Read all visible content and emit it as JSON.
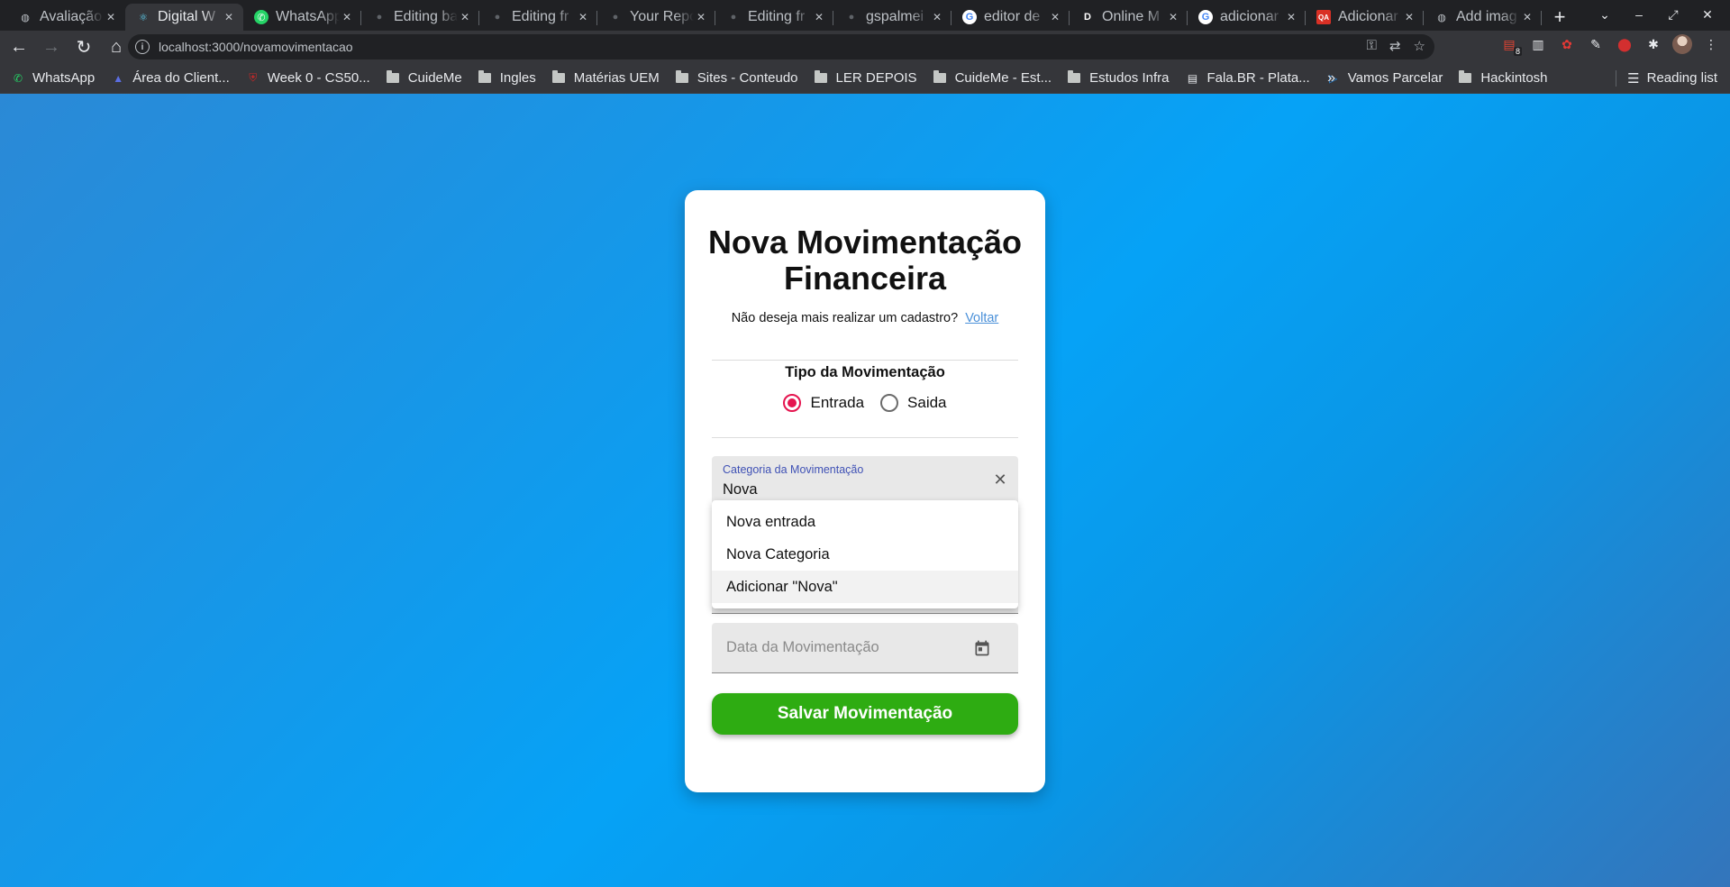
{
  "browser": {
    "tabs": [
      {
        "title": "Avaliação",
        "icon": "globe-icon"
      },
      {
        "title": "Digital W",
        "icon": "react-icon",
        "active": true
      },
      {
        "title": "WhatsApp",
        "icon": "whatsapp-icon"
      },
      {
        "title": "Editing ba",
        "icon": "github-icon"
      },
      {
        "title": "Editing fr",
        "icon": "github-icon"
      },
      {
        "title": "Your Repo",
        "icon": "github-icon"
      },
      {
        "title": "Editing fr",
        "icon": "github-icon"
      },
      {
        "title": "gspalmei",
        "icon": "github-icon"
      },
      {
        "title": "editor de",
        "icon": "google-icon"
      },
      {
        "title": "Online M",
        "icon": "d-icon"
      },
      {
        "title": "adicionar",
        "icon": "google-icon"
      },
      {
        "title": "Adicionar",
        "icon": "qa-icon"
      },
      {
        "title": "Add imag",
        "icon": "globe-icon"
      }
    ],
    "url": "localhost:3000/novamovimentacao",
    "extension_badge": "8",
    "bookmarks": [
      {
        "label": "WhatsApp",
        "icon": "whatsapp-icon"
      },
      {
        "label": "Área do Client...",
        "icon": "logo-icon"
      },
      {
        "label": "Week 0 - CS50...",
        "icon": "cs50-icon"
      },
      {
        "label": "CuideMe",
        "icon": "folder-icon"
      },
      {
        "label": "Ingles",
        "icon": "folder-icon"
      },
      {
        "label": "Matérias  UEM",
        "icon": "folder-icon"
      },
      {
        "label": "Sites - Conteudo",
        "icon": "folder-icon"
      },
      {
        "label": "LER DEPOIS",
        "icon": "folder-icon"
      },
      {
        "label": "CuideMe - Est...",
        "icon": "folder-icon"
      },
      {
        "label": "Estudos Infra",
        "icon": "folder-icon"
      },
      {
        "label": "Fala.BR - Plata...",
        "icon": "doc-icon"
      },
      {
        "label": "Vamos Parcelar",
        "icon": "play-icon"
      },
      {
        "label": "Hackintosh",
        "icon": "folder-icon"
      }
    ],
    "reading_list": "Reading list"
  },
  "form": {
    "title": "Nova Movimentação Financeira",
    "subtitle": "Não deseja mais realizar um cadastro?",
    "back_link": "Voltar",
    "tipo_label": "Tipo da Movimentação",
    "radio_entrada": "Entrada",
    "radio_saida": "Saida",
    "selected_tipo": "Entrada",
    "categoria_label": "Categoria da Movimentação",
    "categoria_value": "Nova",
    "categoria_options": [
      "Nova entrada",
      "Nova Categoria",
      "Adicionar \"Nova\""
    ],
    "data_placeholder": "Data da Movimentação",
    "save_label": "Salvar Movimentação"
  },
  "colors": {
    "accent_radio": "#e5154f",
    "field_focus": "#3f51b5",
    "save_button": "#2eac12",
    "link": "#4a90d9"
  }
}
